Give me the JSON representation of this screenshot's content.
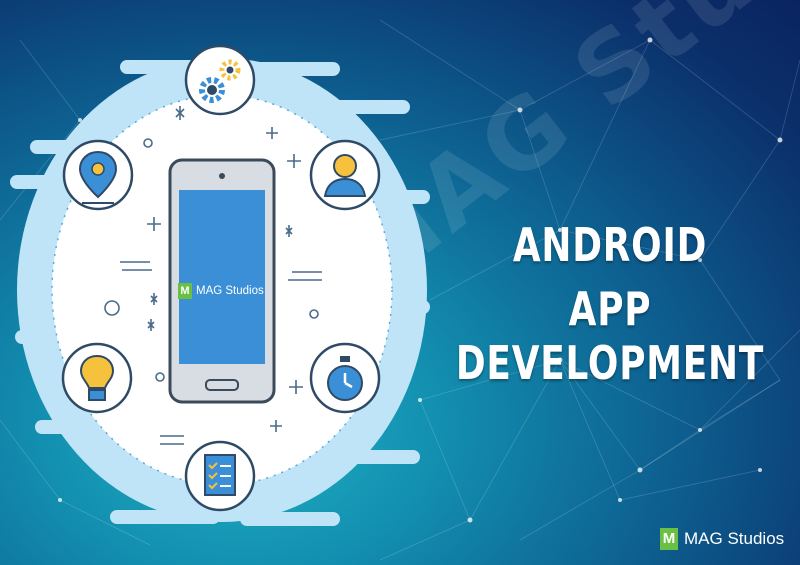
{
  "banner": {
    "title_line1": "ANDROID",
    "title_line2": "APP DEVELOPMENT",
    "watermark_text": "MAG Studios",
    "phone_logo_letter": "M",
    "phone_logo_text": "MAG Studios",
    "corner_logo_letter": "M",
    "corner_logo_text": "MAG Studios"
  },
  "icons": [
    "gears-icon",
    "location-pin-icon",
    "user-icon",
    "lightbulb-icon",
    "stopwatch-icon",
    "checklist-icon",
    "smartphone-icon"
  ],
  "colors": {
    "accent_blue": "#3a8fd6",
    "cloud_blue": "#bfe4f7",
    "brand_green": "#6ac043",
    "icon_yellow": "#f6c23e"
  }
}
